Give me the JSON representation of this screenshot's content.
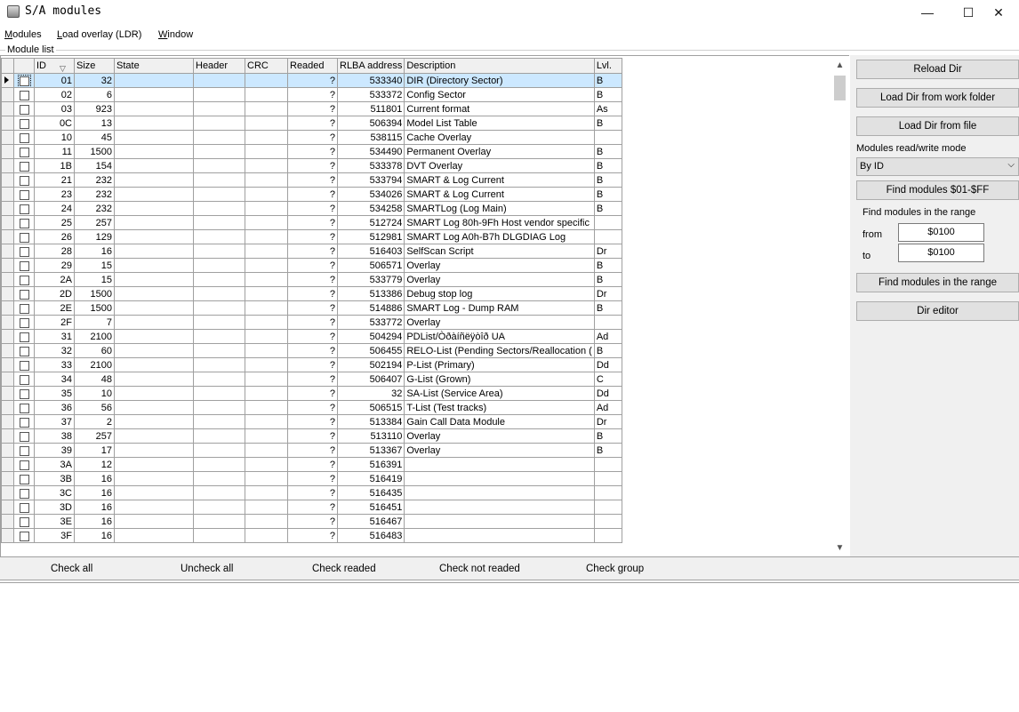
{
  "window": {
    "title": "S/A modules",
    "minimize": "—",
    "maximize": "☐",
    "close": "✕"
  },
  "menu": [
    "Modules",
    "Load overlay (LDR)",
    "Window"
  ],
  "group_label": "Module list",
  "columns": [
    "ID",
    "Size",
    "State",
    "Header",
    "CRC",
    "Readed",
    "RLBA address",
    "Description",
    "Lvl."
  ],
  "sort_indicator": "▽",
  "rows": [
    {
      "id": "01",
      "size": "32",
      "readed": "?",
      "rlba": "533340",
      "desc": "DIR (Directory Sector)",
      "lvl": "B"
    },
    {
      "id": "02",
      "size": "6",
      "readed": "?",
      "rlba": "533372",
      "desc": "Config Sector",
      "lvl": "B"
    },
    {
      "id": "03",
      "size": "923",
      "readed": "?",
      "rlba": "511801",
      "desc": "Current format",
      "lvl": "As"
    },
    {
      "id": "0C",
      "size": "13",
      "readed": "?",
      "rlba": "506394",
      "desc": "Model List Table",
      "lvl": "B"
    },
    {
      "id": "10",
      "size": "45",
      "readed": "?",
      "rlba": "538115",
      "desc": "Cache Overlay",
      "lvl": ""
    },
    {
      "id": "11",
      "size": "1500",
      "readed": "?",
      "rlba": "534490",
      "desc": "Permanent Overlay",
      "lvl": "B"
    },
    {
      "id": "1B",
      "size": "154",
      "readed": "?",
      "rlba": "533378",
      "desc": "DVT Overlay",
      "lvl": "B"
    },
    {
      "id": "21",
      "size": "232",
      "readed": "?",
      "rlba": "533794",
      "desc": "SMART & Log Current",
      "lvl": "B"
    },
    {
      "id": "23",
      "size": "232",
      "readed": "?",
      "rlba": "534026",
      "desc": "SMART & Log Current",
      "lvl": "B"
    },
    {
      "id": "24",
      "size": "232",
      "readed": "?",
      "rlba": "534258",
      "desc": "SMARTLog (Log Main)",
      "lvl": "B"
    },
    {
      "id": "25",
      "size": "257",
      "readed": "?",
      "rlba": "512724",
      "desc": "SMART Log 80h-9Fh Host vendor specific",
      "lvl": ""
    },
    {
      "id": "26",
      "size": "129",
      "readed": "?",
      "rlba": "512981",
      "desc": "SMART Log A0h-B7h DLGDIAG Log",
      "lvl": ""
    },
    {
      "id": "28",
      "size": "16",
      "readed": "?",
      "rlba": "516403",
      "desc": "SelfScan Script",
      "lvl": "Dr"
    },
    {
      "id": "29",
      "size": "15",
      "readed": "?",
      "rlba": "506571",
      "desc": "Overlay",
      "lvl": "B"
    },
    {
      "id": "2A",
      "size": "15",
      "readed": "?",
      "rlba": "533779",
      "desc": "Overlay",
      "lvl": "B"
    },
    {
      "id": "2D",
      "size": "1500",
      "readed": "?",
      "rlba": "513386",
      "desc": "Debug stop log",
      "lvl": "Dr"
    },
    {
      "id": "2E",
      "size": "1500",
      "readed": "?",
      "rlba": "514886",
      "desc": "SMART Log - Dump RAM",
      "lvl": "B"
    },
    {
      "id": "2F",
      "size": "7",
      "readed": "?",
      "rlba": "533772",
      "desc": "Overlay",
      "lvl": ""
    },
    {
      "id": "31",
      "size": "2100",
      "readed": "?",
      "rlba": "504294",
      "desc": "PDList/Òðàíñëÿòîð UA",
      "lvl": "Ad"
    },
    {
      "id": "32",
      "size": "60",
      "readed": "?",
      "rlba": "506455",
      "desc": "RELO-List (Pending Sectors/Reallocation (",
      "lvl": "B"
    },
    {
      "id": "33",
      "size": "2100",
      "readed": "?",
      "rlba": "502194",
      "desc": "P-List (Primary)",
      "lvl": "Dd"
    },
    {
      "id": "34",
      "size": "48",
      "readed": "?",
      "rlba": "506407",
      "desc": "G-List (Grown)",
      "lvl": "C"
    },
    {
      "id": "35",
      "size": "10",
      "readed": "?",
      "rlba": "32",
      "desc": "SA-List (Service Area)",
      "lvl": "Dd"
    },
    {
      "id": "36",
      "size": "56",
      "readed": "?",
      "rlba": "506515",
      "desc": "T-List (Test tracks)",
      "lvl": "Ad"
    },
    {
      "id": "37",
      "size": "2",
      "readed": "?",
      "rlba": "513384",
      "desc": "Gain Call Data Module",
      "lvl": "Dr"
    },
    {
      "id": "38",
      "size": "257",
      "readed": "?",
      "rlba": "513110",
      "desc": "Overlay",
      "lvl": "B"
    },
    {
      "id": "39",
      "size": "17",
      "readed": "?",
      "rlba": "513367",
      "desc": "Overlay",
      "lvl": "B"
    },
    {
      "id": "3A",
      "size": "12",
      "readed": "?",
      "rlba": "516391",
      "desc": "",
      "lvl": ""
    },
    {
      "id": "3B",
      "size": "16",
      "readed": "?",
      "rlba": "516419",
      "desc": "",
      "lvl": ""
    },
    {
      "id": "3C",
      "size": "16",
      "readed": "?",
      "rlba": "516435",
      "desc": "",
      "lvl": ""
    },
    {
      "id": "3D",
      "size": "16",
      "readed": "?",
      "rlba": "516451",
      "desc": "",
      "lvl": ""
    },
    {
      "id": "3E",
      "size": "16",
      "readed": "?",
      "rlba": "516467",
      "desc": "",
      "lvl": ""
    },
    {
      "id": "3F",
      "size": "16",
      "readed": "?",
      "rlba": "516483",
      "desc": "",
      "lvl": ""
    }
  ],
  "right": {
    "reload_dir": "Reload Dir",
    "load_dir_work": "Load Dir from work folder",
    "load_dir_file": "Load Dir from file",
    "mode_label": "Modules read/write mode",
    "mode_value": "By ID",
    "find_01_ff": "Find modules $01-$FF",
    "range_label": "Find modules in the range",
    "from_label": "from",
    "from_value": "$0100",
    "to_label": "to",
    "to_value": "$0100",
    "find_range": "Find modules in the range",
    "dir_editor": "Dir editor"
  },
  "bottom": [
    "Check all",
    "Uncheck all",
    "Check readed",
    "Check not readed",
    "Check group"
  ],
  "colors": {
    "selection": "#cce8ff",
    "panel": "#f0f0f0",
    "button": "#e1e1e1"
  }
}
